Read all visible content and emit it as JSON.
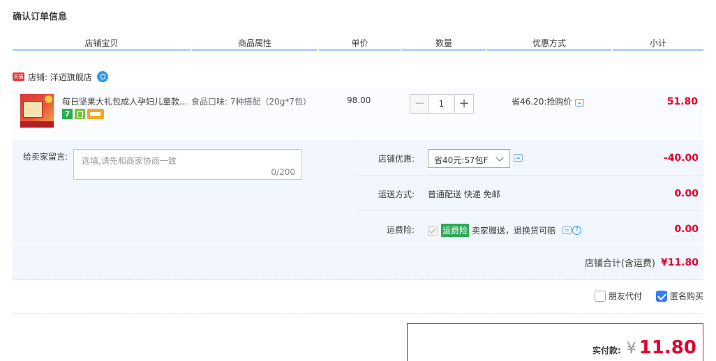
{
  "page": {
    "title": "确认订单信息"
  },
  "columns": [
    "店铺宝贝",
    "商品属性",
    "单价",
    "数量",
    "优惠方式",
    "小计"
  ],
  "shop": {
    "badge": "天猫",
    "label": "店铺: 洋迈旗舰店"
  },
  "item": {
    "title": "每日坚果大礼包成人孕妇儿童款...",
    "attr": "食品口味: 7种搭配（20g*7包）",
    "price": "98.00",
    "qty_minus": "−",
    "qty": "1",
    "qty_plus": "+",
    "discount": "省46.20:抢购价",
    "subtotal": "51.80",
    "icon_seven": "7"
  },
  "message": {
    "label": "给卖家留言:",
    "placeholder": "选填,请先和商家协商一致",
    "count": "0/200"
  },
  "shop_discount": {
    "label": "店铺优惠:",
    "selected": "省40元:S7包F",
    "amount": "-40.00"
  },
  "shipping": {
    "label": "运送方式:",
    "value": "普通配送 快递 免邮",
    "amount": "0.00"
  },
  "insurance": {
    "label": "运费险:",
    "tag": "运费险",
    "text": "卖家赠送，退换货可赔",
    "amount": "0.00",
    "help": "?"
  },
  "store_total": {
    "label": "店铺合计(含运费)",
    "value": "¥11.80"
  },
  "options": {
    "friend_pay": "朋友代付",
    "friend_pay_checked": false,
    "anonymous": "匿名购买",
    "anonymous_checked": true
  },
  "payment": {
    "label": "实付款:",
    "currency": "¥",
    "value": "11.80"
  },
  "colors": {
    "accent": "#e4002b",
    "header_line": "#b2d1ff",
    "panel_bg": "#f2f7ff",
    "checkbox_on": "#3a7ef0",
    "insurance_tag": "#2eaa57"
  }
}
